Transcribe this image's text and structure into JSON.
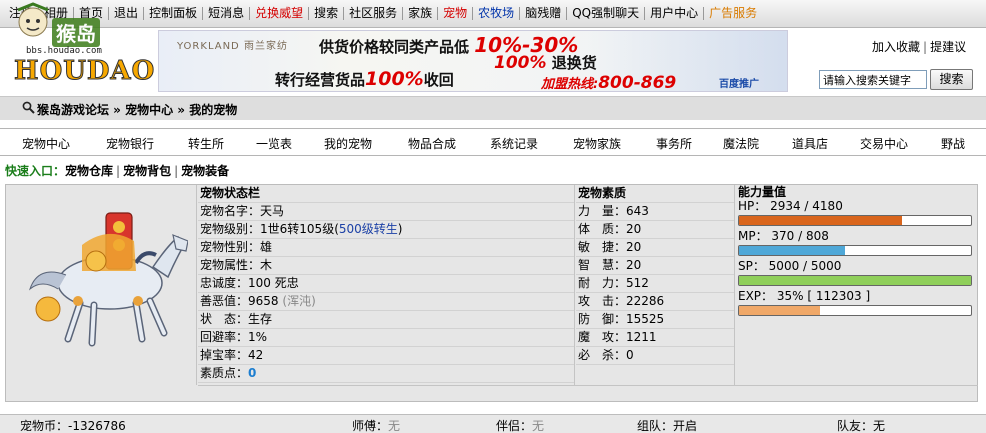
{
  "top_nav": [
    {
      "label": "注册",
      "style": ""
    },
    {
      "label": "相册",
      "style": ""
    },
    {
      "label": "首页",
      "style": ""
    },
    {
      "label": "退出",
      "style": ""
    },
    {
      "label": "控制面板",
      "style": ""
    },
    {
      "label": "短消息",
      "style": ""
    },
    {
      "label": "兑换威望",
      "style": "red"
    },
    {
      "label": "搜索",
      "style": ""
    },
    {
      "label": "社区服务",
      "style": ""
    },
    {
      "label": "家族",
      "style": ""
    },
    {
      "label": "宠物",
      "style": "red"
    },
    {
      "label": "农牧场",
      "style": "blue"
    },
    {
      "label": "脑残赠",
      "style": ""
    },
    {
      "label": "QQ强制聊天",
      "style": ""
    },
    {
      "label": "用户中心",
      "style": ""
    },
    {
      "label": "广告服务",
      "style": "orange"
    }
  ],
  "logo": {
    "cn": "猴岛",
    "url": "bbs.houdao.com",
    "wordmark": "HOUDAO"
  },
  "banner": {
    "brand": "YORKLAND 雨兰家纺",
    "line1_prefix": "供货价格较同类产品低",
    "line1_highlight": "10%-30%",
    "line2_highlight": "100%",
    "line2_suffix": "退换货",
    "line3_prefix": "转行经营货品",
    "line3_highlight": "100%",
    "line3_suffix": "收回",
    "line4_prefix": "加盟热线:",
    "line4_highlight": "800-869",
    "sponsor": "百度推广"
  },
  "header_links": {
    "bookmark": "加入收藏",
    "suggest": "提建议"
  },
  "search": {
    "value": "请输入搜索关键字",
    "button": "搜索"
  },
  "breadcrumb": "猴岛游戏论坛 » 宠物中心 » 我的宠物",
  "main_nav": [
    "宠物中心",
    "宠物银行",
    "转生所",
    "一览表",
    "我的宠物",
    "物品合成",
    "系统记录",
    "宠物家族",
    "事务所",
    "魔法院",
    "道具店",
    "交易中心",
    "野战"
  ],
  "quick": {
    "label": "快速入口：",
    "items": [
      "宠物仓库",
      "宠物背包",
      "宠物装备"
    ]
  },
  "status": {
    "title": "宠物状态栏",
    "name_label": "宠物名字：",
    "name": "天马",
    "level_label": "宠物级别：",
    "level": "1世6转105级(",
    "level_link": "500级转生",
    "level_close": ")",
    "gender_label": "宠物性别：",
    "gender": "雄",
    "element_label": "宠物属性：",
    "element": "木",
    "loyalty_label": "忠诚度：",
    "loyalty": "100 死忠",
    "karma_label": "善恶值：",
    "karma": "9658",
    "karma_tag": "(浑沌)",
    "state_label": "状　态：",
    "state": "生存",
    "dodge_label": "回避率：",
    "dodge": "1%",
    "drop_label": "掉宝率：",
    "drop": "42",
    "points_label": "素质点：",
    "points": "0"
  },
  "quality": {
    "title": "宠物素质",
    "rows": [
      {
        "label": "力　量：",
        "value": "643"
      },
      {
        "label": "体　质：",
        "value": "20"
      },
      {
        "label": "敏　捷：",
        "value": "20"
      },
      {
        "label": "智　慧：",
        "value": "20"
      },
      {
        "label": "耐　力：",
        "value": "512"
      },
      {
        "label": "攻　击：",
        "value": "22286"
      },
      {
        "label": "防　御：",
        "value": "15525"
      },
      {
        "label": "魔　攻：",
        "value": "1211"
      },
      {
        "label": "必　杀：",
        "value": "0"
      }
    ]
  },
  "ability": {
    "title": "能力量值",
    "hp_text": "HP： 2934 / 4180",
    "hp_fraction": 0.702,
    "mp_text": "MP： 370 / 808",
    "mp_fraction": 0.458,
    "sp_text": "SP： 5000 / 5000",
    "sp_fraction": 1.0,
    "exp_text": "EXP： 35% [ 112303 ]",
    "exp_fraction": 0.35,
    "colors": {
      "hp": "#d9651c",
      "mp": "#4fa8d8",
      "sp": "#8fcf5a",
      "exp": "#f0a868"
    }
  },
  "footer": {
    "coin_label": "宠物币：",
    "coin": "-1326786",
    "master_label": "师傅：",
    "master": "无",
    "partner_label": "伴侣：",
    "partner": "无",
    "team_label": "组队：",
    "team": "开启",
    "mate_label": "队友：",
    "mate": "无"
  }
}
